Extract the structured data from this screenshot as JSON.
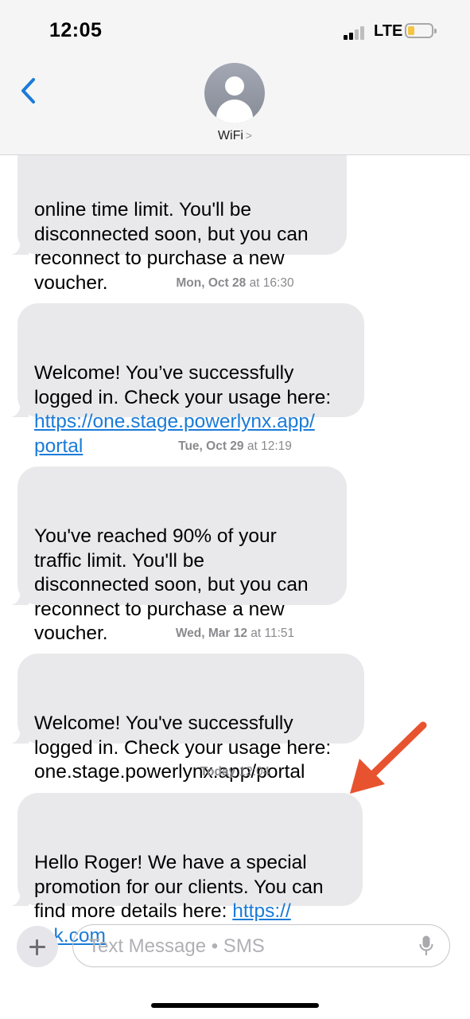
{
  "status_bar": {
    "time": "12:05",
    "network": "LTE"
  },
  "header": {
    "contact_name": "WiFi",
    "contact_chevron": ">"
  },
  "messages": [
    {
      "text": "online time limit. You'll be\ndisconnected soon, but you can\nreconnect to purchase a new\nvoucher."
    },
    {
      "timestamp_day": "Mon, Oct 28",
      "timestamp_time": "at 16:30",
      "text_before": "Welcome! You’ve successfully\nlogged in. Check your usage here:\n",
      "link": "https://one.stage.powerlynx.app/\nportal"
    },
    {
      "timestamp_day": "Tue, Oct 29",
      "timestamp_time": "at 12:19",
      "text": "You've reached 90% of your\ntraffic limit. You'll be\ndisconnected soon, but you can\nreconnect to purchase a new\nvoucher."
    },
    {
      "timestamp_day": "Wed, Mar 12",
      "timestamp_time": "at 11:51",
      "text": "Welcome! You've successfully\nlogged in. Check your usage here:\none.stage.powerlynx.app/portal"
    },
    {
      "timestamp_day": "Today",
      "timestamp_time": "12:04",
      "text_before": "Hello Roger! We have a special\npromotion for our clients. You can\nfind more details here: ",
      "link": "https://\nlink.com"
    }
  ],
  "composer": {
    "placeholder": "Text Message • SMS"
  },
  "colors": {
    "bubble": "#e9e9eb",
    "link": "#1a7bd8",
    "accent": "#1a7bd8",
    "annotation_arrow": "#e8532f"
  },
  "icons": {
    "back": "chevron-left-icon",
    "avatar": "person-icon",
    "add": "plus-icon",
    "mic": "microphone-icon",
    "annotation": "arrow-icon"
  }
}
